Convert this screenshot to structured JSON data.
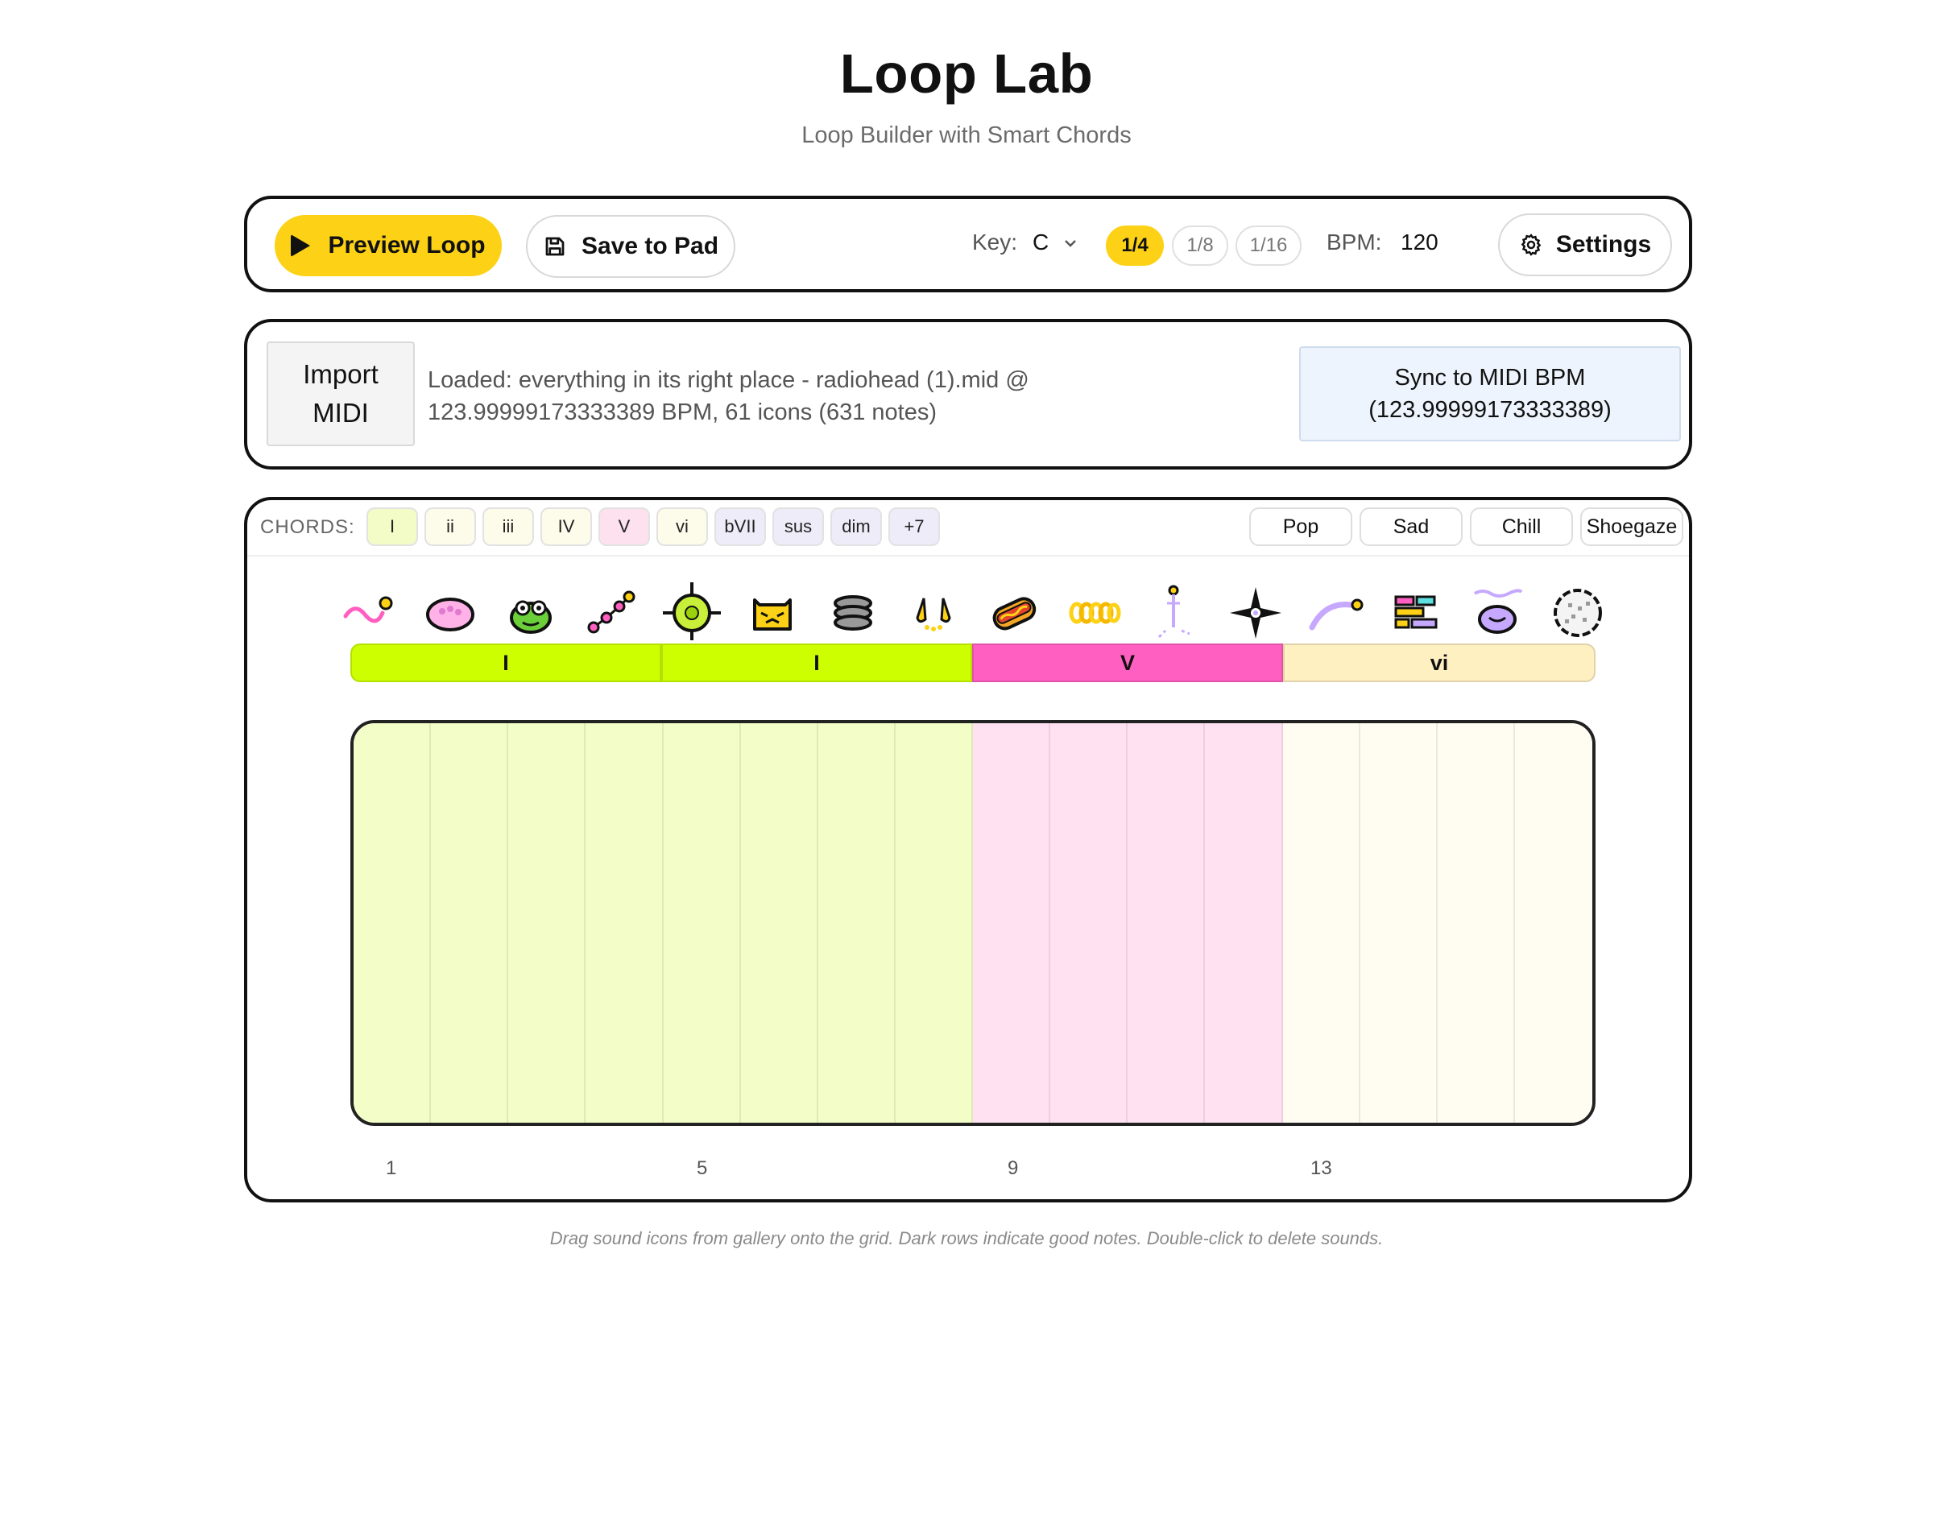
{
  "header": {
    "title": "Loop Lab",
    "subtitle": "Loop Builder with Smart Chords"
  },
  "toolbar": {
    "preview_label": "Preview Loop",
    "save_label": "Save to Pad",
    "key_label": "Key:",
    "key_value": "C",
    "resolution_options": [
      "1/4",
      "1/8",
      "1/16"
    ],
    "resolution_selected": "1/4",
    "bpm_label": "BPM:",
    "bpm_value": "120",
    "settings_label": "Settings"
  },
  "midi": {
    "import_label": "Import\nMIDI",
    "status": "Loaded: everything in its right place - radiohead (1).mid @ 123.99999173333389 BPM, 61 icons (631 notes)",
    "sync_label": "Sync to MIDI BPM\n(123.99999173333389)"
  },
  "chords": {
    "label": "CHORDS:",
    "buttons": [
      {
        "label": "I",
        "color": "#f3fcc6"
      },
      {
        "label": "ii",
        "color": "#fdfbea"
      },
      {
        "label": "iii",
        "color": "#fdfbea"
      },
      {
        "label": "IV",
        "color": "#fdfbea"
      },
      {
        "label": "V",
        "color": "#fde1ee"
      },
      {
        "label": "vi",
        "color": "#fdfbea"
      },
      {
        "label": "bVII",
        "color": "#efecf9"
      },
      {
        "label": "sus",
        "color": "#efecf9"
      },
      {
        "label": "dim",
        "color": "#efecf9"
      },
      {
        "label": "+7",
        "color": "#efecf9"
      }
    ],
    "presets": [
      "Pop",
      "Sad",
      "Chill",
      "Shoegaze"
    ]
  },
  "gallery": {
    "icons": [
      "squiggle-icon",
      "pink-blob-icon",
      "frog-icon",
      "dots-chain-icon",
      "crosshair-icon",
      "cat-face-icon",
      "stack-icon",
      "drops-icon",
      "hotdog-icon",
      "coil-icon",
      "anchor-icon",
      "sparkle-icon",
      "arc-icon",
      "bricks-icon",
      "smile-icon",
      "dotted-ball-icon"
    ]
  },
  "progression": [
    {
      "label": "I",
      "color": "#cdff00"
    },
    {
      "label": "I",
      "color": "#cdff00"
    },
    {
      "label": "V",
      "color": "#ff5fc0"
    },
    {
      "label": "vi",
      "color": "#fff0c2"
    }
  ],
  "grid": {
    "steps": 16,
    "step_colors": [
      "#f3fdc8",
      "#f3fdc8",
      "#f3fdc8",
      "#f3fdc8",
      "#f3fdc8",
      "#f3fdc8",
      "#f3fdc8",
      "#f3fdc8",
      "#ffe1f2",
      "#ffe1f2",
      "#ffe1f2",
      "#ffe1f2",
      "#fffcf2",
      "#fffcf2",
      "#fffcf2",
      "#fffcf2"
    ],
    "beat_numbers": [
      "1",
      "5",
      "9",
      "13"
    ]
  },
  "footer": "Drag sound icons from gallery onto the grid. Dark rows indicate good notes. Double-click to delete sounds."
}
